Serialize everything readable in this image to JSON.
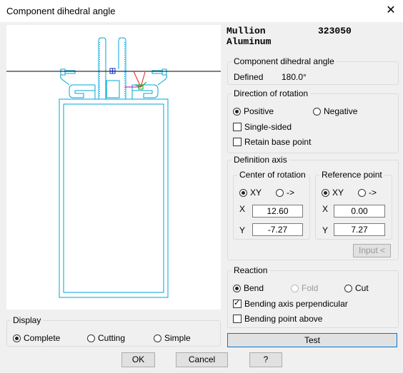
{
  "window": {
    "title": "Component dihedral angle",
    "close_glyph": "✕"
  },
  "header": {
    "profile_name": "Mullion",
    "profile_number": "323050",
    "material": "Aluminum"
  },
  "component_angle": {
    "legend": "Component dihedral angle",
    "label": "Defined",
    "value": "180.0°"
  },
  "direction": {
    "legend": "Direction of rotation",
    "positive": "Positive",
    "negative": "Negative",
    "single_sided": "Single-sided",
    "retain_base": "Retain base point"
  },
  "definition_axis": {
    "legend": "Definition axis",
    "center": {
      "legend": "Center of rotation",
      "xy": "XY",
      "arrow": "->",
      "x_label": "X",
      "x_value": "12.60",
      "y_label": "Y",
      "y_value": "-7.27"
    },
    "reference": {
      "legend": "Reference point",
      "xy": "XY",
      "arrow": "->",
      "x_label": "X",
      "x_value": "0.00",
      "y_label": "Y",
      "y_value": "7.27"
    },
    "input_button": "Input <"
  },
  "reaction": {
    "legend": "Reaction",
    "bend": "Bend",
    "fold": "Fold",
    "cut": "Cut",
    "bending_axis_perpendicular": "Bending axis perpendicular",
    "bending_point_above": "Bending point above"
  },
  "display": {
    "legend": "Display",
    "complete": "Complete",
    "cutting": "Cutting",
    "simple": "Simple"
  },
  "buttons": {
    "test": "Test",
    "ok": "OK",
    "cancel": "Cancel",
    "help": "?"
  },
  "colors": {
    "profile_outline": "#00a6d6",
    "axis_line": "#000000",
    "marker_red": "#e02020",
    "marker_green": "#10a010",
    "marker_magenta": "#c000c0",
    "marker_blue": "#1030c0"
  }
}
